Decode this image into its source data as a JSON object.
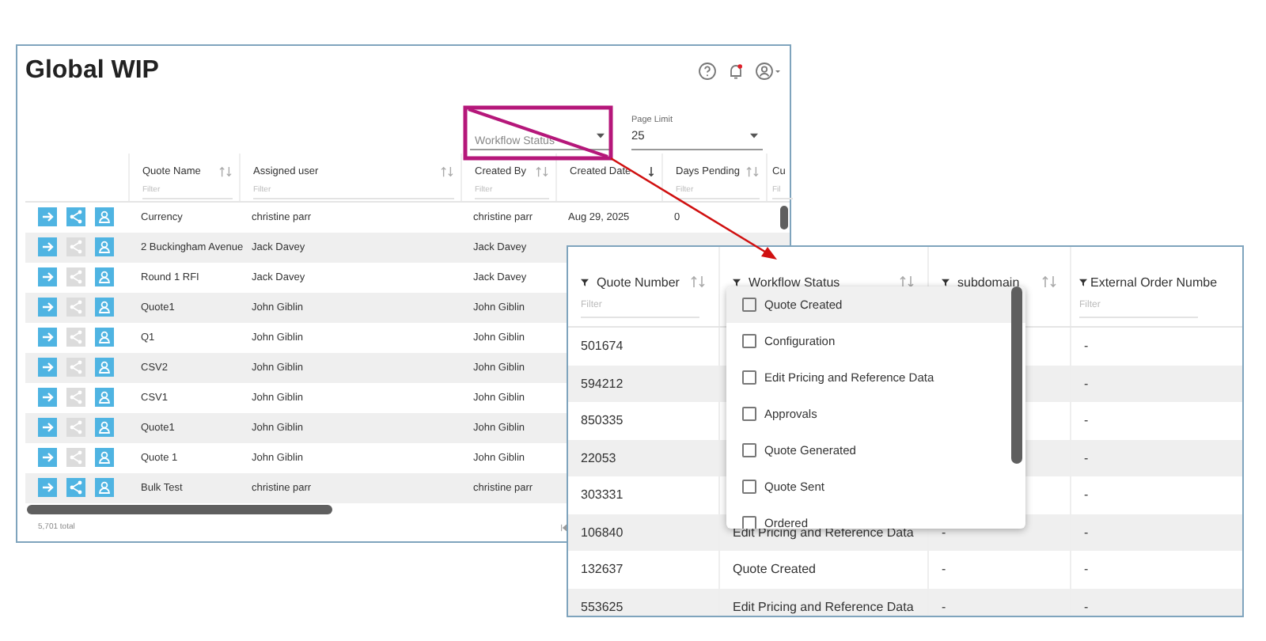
{
  "main_window": {
    "title": "Global WIP",
    "filters": {
      "workflow_status": {
        "placeholder": "Workflow Status",
        "highlighted": true
      },
      "page_limit": {
        "label": "Page Limit",
        "value": "25"
      }
    },
    "table": {
      "columns": [
        {
          "label": "Quote Name",
          "filter_placeholder": "Filter",
          "sorted": false
        },
        {
          "label": "Assigned user",
          "filter_placeholder": "Filter",
          "sorted": false
        },
        {
          "label": "Created By",
          "filter_placeholder": "Filter",
          "sorted": false
        },
        {
          "label": "Created Date",
          "sorted": true
        },
        {
          "label": "Days Pending",
          "filter_placeholder": "Filter",
          "sorted": false
        },
        {
          "label": "Cu",
          "filter_placeholder": "Fil"
        }
      ],
      "rows": [
        {
          "share_enabled": true,
          "cells": [
            "Currency",
            "christine parr",
            "christine parr",
            "Aug 29, 2025",
            "0"
          ]
        },
        {
          "share_enabled": false,
          "cells": [
            "2 Buckingham Avenue",
            "Jack Davey",
            "Jack Davey"
          ]
        },
        {
          "share_enabled": false,
          "cells": [
            "Round 1 RFI",
            "Jack Davey",
            "Jack Davey"
          ]
        },
        {
          "share_enabled": false,
          "cells": [
            "Quote1",
            "John Giblin",
            "John Giblin"
          ]
        },
        {
          "share_enabled": false,
          "cells": [
            "Q1",
            "John Giblin",
            "John Giblin"
          ]
        },
        {
          "share_enabled": false,
          "cells": [
            "CSV2",
            "John Giblin",
            "John Giblin"
          ]
        },
        {
          "share_enabled": false,
          "cells": [
            "CSV1",
            "John Giblin",
            "John Giblin"
          ]
        },
        {
          "share_enabled": false,
          "cells": [
            "Quote1",
            "John Giblin",
            "John Giblin"
          ]
        },
        {
          "share_enabled": false,
          "cells": [
            "Quote 1",
            "John Giblin",
            "John Giblin"
          ]
        },
        {
          "share_enabled": true,
          "cells": [
            "Bulk Test",
            "christine parr",
            "christine parr"
          ]
        }
      ]
    },
    "footer": {
      "total": "5,701 total"
    }
  },
  "zoomed_view": {
    "columns": [
      {
        "label": "Quote Number",
        "filter_placeholder": "Filter"
      },
      {
        "label": "Workflow Status"
      },
      {
        "label": "subdomain"
      },
      {
        "label": "External Order Numbe",
        "filter_placeholder": "Filter"
      }
    ],
    "rows": [
      {
        "cells": [
          "501674",
          "",
          "",
          "-"
        ]
      },
      {
        "cells": [
          "594212",
          "",
          "",
          "-"
        ]
      },
      {
        "cells": [
          "850335",
          "",
          "",
          "-"
        ]
      },
      {
        "cells": [
          "22053",
          "",
          "",
          "-"
        ]
      },
      {
        "cells": [
          "303331",
          "",
          "",
          "-"
        ]
      },
      {
        "cells": [
          "106840",
          "Edit Pricing and Reference Data",
          "-",
          "-"
        ]
      },
      {
        "cells": [
          "132637",
          "Quote Created",
          "-",
          "-"
        ]
      },
      {
        "cells": [
          "553625",
          "Edit Pricing and Reference Data",
          "-",
          "-"
        ]
      }
    ],
    "dropdown": {
      "options": [
        {
          "label": "Quote Created",
          "checked": false,
          "hovered": true
        },
        {
          "label": "Configuration",
          "checked": false,
          "hovered": false
        },
        {
          "label": "Edit Pricing and Reference Data",
          "checked": false,
          "hovered": false
        },
        {
          "label": "Approvals",
          "checked": false,
          "hovered": false
        },
        {
          "label": "Quote Generated",
          "checked": false,
          "hovered": false
        },
        {
          "label": "Quote Sent",
          "checked": false,
          "hovered": false
        },
        {
          "label": "Ordered",
          "checked": false,
          "hovered": false
        }
      ]
    }
  }
}
